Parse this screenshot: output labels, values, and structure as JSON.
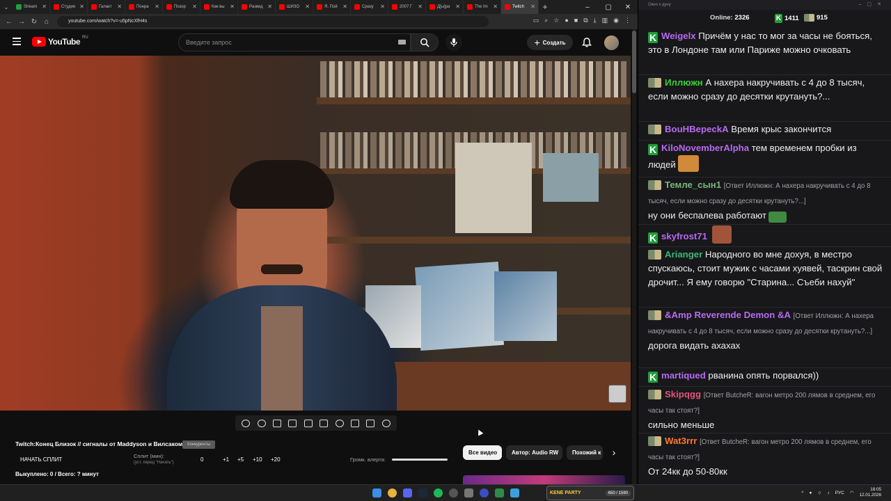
{
  "browser": {
    "tabs": [
      {
        "label": "Stream",
        "color": "#1f9e3a"
      },
      {
        "label": "Студия",
        "color": "#ff0000"
      },
      {
        "label": "Галакт",
        "color": "#ff0000"
      },
      {
        "label": "Понра",
        "color": "#ff0000"
      },
      {
        "label": "Позор",
        "color": "#ff0000"
      },
      {
        "label": "Как вы",
        "color": "#ff0000"
      },
      {
        "label": "Развед",
        "color": "#ff0000"
      },
      {
        "label": "ШИЗО",
        "color": "#ff0000"
      },
      {
        "label": "Я. Пой",
        "color": "#ff0000"
      },
      {
        "label": "Сразу",
        "color": "#ff0000"
      },
      {
        "label": "2007 Г",
        "color": "#ff0000"
      },
      {
        "label": "Д[ы]ра",
        "color": "#ff0000"
      },
      {
        "label": "The Im",
        "color": "#ff0000"
      },
      {
        "label": "Twitch",
        "color": "#ff0000",
        "active": true
      }
    ],
    "url": "youtube.com/watch?v=-u5pNcXfH4s"
  },
  "youtube": {
    "logo_text": "YouTube",
    "region": "RU",
    "search_placeholder": "Введите запрос",
    "create_label": "Создать"
  },
  "video": {
    "title": "Twitch:Конец Близок // сигналы от Maddyson и Вилсаком",
    "title_badge": "Конкуренты",
    "start_split": "НАЧАТЬ СПЛИТ",
    "split_label": "Сплит (мин):",
    "split_hint": "(уст. перед \"Начать\")",
    "split_values": [
      "0",
      "+1",
      "+5",
      "+10",
      "+20"
    ],
    "alert_label": "Громк. алерта:",
    "alert_volume": 1.0,
    "bought": "Выкуплено: 0 / Всего: ? минут"
  },
  "chips": [
    "Все видео",
    "Автор: Audio RW",
    "Похожий к"
  ],
  "chat": {
    "window_title": "Окно к дуну",
    "online_label": "Online:",
    "online_count": "2326",
    "k_count": "1411",
    "p_count": "915",
    "messages": [
      {
        "badge": "k",
        "user": "Weigelx",
        "color": "#b86af0",
        "text": "Причём у нас то мог за часы не бояться, это в Лондоне там или Париже можно очковать"
      },
      {
        "badge": "p",
        "user": "Иллюжн",
        "color": "#3ad13a",
        "text": "А нахера накручивать с 4 до 8 тысяч, если можно сразу до десятки крутануть?..."
      },
      {
        "badge": "p",
        "user": "BouHBepeckA",
        "color": "#b86af0",
        "text": "Время крыс закончится"
      },
      {
        "badge": "k",
        "user": "KiloNovemberAlpha",
        "color": "#b86af0",
        "text": "тем временем пробки из людей"
      },
      {
        "badge": "p",
        "user": "Темле_сын1",
        "color": "#78b878",
        "reply": "[Ответ Иллюжн: А нахера накручивать с 4 до 8 тысяч, если можно сразу до десятки крутануть?...]",
        "text": "ну они беспалева работают"
      },
      {
        "badge": "k",
        "user": "skyfrost71",
        "color": "#b86af0",
        "text": ""
      },
      {
        "badge": "p",
        "user": "Arianger",
        "color": "#3ab878",
        "text": "Народного во мне дохуя, в местро спускаюсь, стоит мужик с часами хуявей, таскрин свой дрочит... Я ему говорю \"Старина... Съеби нахуй\""
      },
      {
        "badge": "p",
        "user": "&Amp Reverende Demon &A",
        "color": "#b86af0",
        "reply": "[Ответ Иллюжн: А нахера накручивать с 4 до 8 тысяч, если можно сразу до десятки крутануть?...]",
        "text": "дорога видать ахахах"
      },
      {
        "badge": "k",
        "user": "martiqued",
        "color": "#b86af0",
        "text": "рванина опять порвался))"
      },
      {
        "badge": "p",
        "user": "Skipqgg",
        "color": "#e0557a",
        "reply": "[Ответ ButcheR: вагон метро 200 лямов в среднем, его часы так стоят?]",
        "text": "сильно меньше"
      },
      {
        "badge": "p",
        "user": "Wat3rrr",
        "color": "#ff7a2a",
        "reply": "[Ответ ButcheR: вагон метро 200 лямов в среднем, его часы так стоят?]",
        "text": "От 24кк до 50-80кк"
      }
    ]
  },
  "taskbar": {
    "widget_title": "KENE PARTY",
    "widget_count": "650 / 1590",
    "lang": "РУС",
    "time": "18:05",
    "date": "12.01.2026"
  }
}
